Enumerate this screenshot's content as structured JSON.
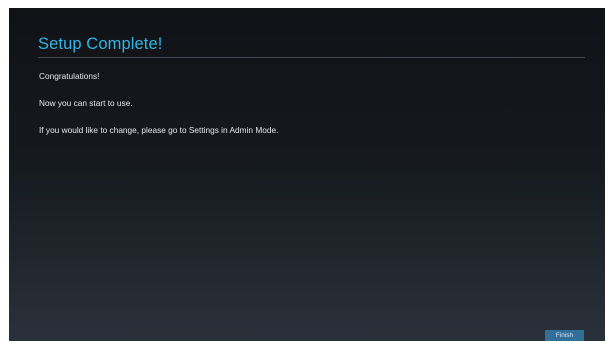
{
  "setup": {
    "title": "Setup Complete!",
    "messages": [
      "Congratulations!",
      "Now you can start to use.",
      "If you would like to change, please go to Settings in Admin Mode."
    ],
    "finish_label": "Finish"
  },
  "colors": {
    "accent": "#33b5e5",
    "button": "#2f6f99"
  }
}
